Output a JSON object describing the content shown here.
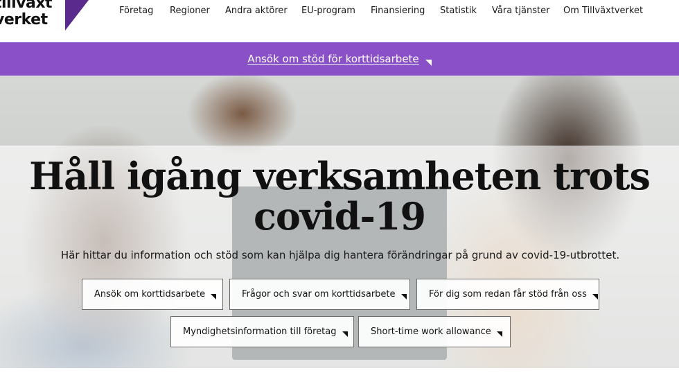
{
  "logo": {
    "line1": "tillväxt",
    "line2": "verket"
  },
  "nav": [
    {
      "label": "Företag"
    },
    {
      "label": "Regioner"
    },
    {
      "label": "Andra aktörer"
    },
    {
      "label": "EU-program"
    },
    {
      "label": "Finansiering"
    },
    {
      "label": "Statistik"
    },
    {
      "label": "Våra tjänster"
    },
    {
      "label": "Om Tillväxtverket"
    }
  ],
  "banner": {
    "label": "Ansök om stöd för korttidsarbete",
    "icon": "external-link-icon"
  },
  "hero": {
    "title_line1": "Håll igång verksamheten trots",
    "title_line2": "covid-19",
    "subtitle": "Här hittar du information och stöd som kan hjälpa dig hantera förändringar på grund av covid-19-utbrottet.",
    "buttons": [
      {
        "label": "Ansök om korttidsarbete"
      },
      {
        "label": "Frågor och svar om korttidsarbete"
      },
      {
        "label": "För dig som redan får stöd från oss"
      },
      {
        "label": "Myndighetsinformation till företag"
      },
      {
        "label": "Short-time work allowance"
      }
    ]
  },
  "colors": {
    "banner": "#8a50c8",
    "logo_mark": "#5a2a8c",
    "text": "#111111"
  }
}
